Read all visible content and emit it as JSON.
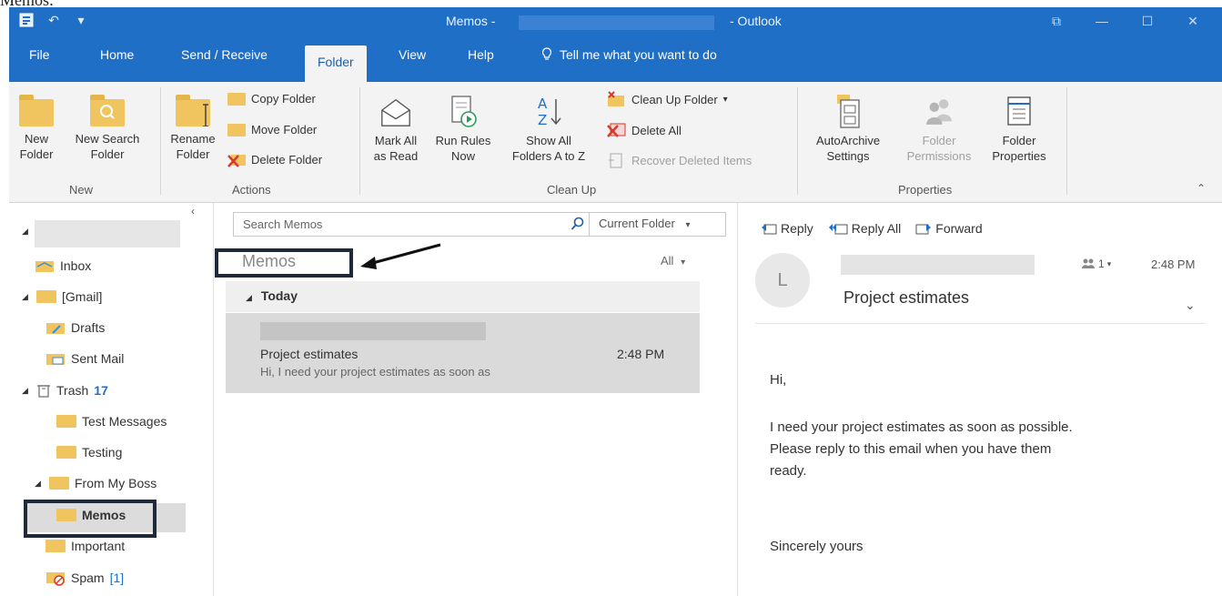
{
  "caption_fragment": "Memos:",
  "window": {
    "title_prefix": "Memos -",
    "title_app": "- Outlook"
  },
  "tabs": [
    {
      "label": "File"
    },
    {
      "label": "Home"
    },
    {
      "label": "Send / Receive"
    },
    {
      "label": "Folder"
    },
    {
      "label": "View"
    },
    {
      "label": "Help"
    }
  ],
  "active_tab": "Folder",
  "tell_me": "Tell me what you want to do",
  "ribbon": {
    "new_group": {
      "label": "New",
      "new_folder": [
        "New",
        "Folder"
      ],
      "new_search_folder": [
        "New Search",
        "Folder"
      ]
    },
    "actions_group": {
      "label": "Actions",
      "rename_folder": [
        "Rename",
        "Folder"
      ],
      "copy_folder": "Copy Folder",
      "move_folder": "Move Folder",
      "delete_folder": "Delete Folder"
    },
    "cleanup_group": {
      "label": "Clean Up",
      "mark_all_read": [
        "Mark All",
        "as Read"
      ],
      "run_rules": [
        "Run Rules",
        "Now"
      ],
      "show_all": [
        "Show All",
        "Folders A to Z"
      ],
      "clean_up_folder": "Clean Up Folder",
      "delete_all": "Delete All",
      "recover_deleted": "Recover Deleted Items"
    },
    "properties_group": {
      "label": "Properties",
      "autoarchive": [
        "AutoArchive",
        "Settings"
      ],
      "folder_permissions": [
        "Folder",
        "Permissions"
      ],
      "folder_properties": [
        "Folder",
        "Properties"
      ]
    }
  },
  "nav": {
    "inbox": "Inbox",
    "gmail": "[Gmail]",
    "drafts": "Drafts",
    "sent_mail": "Sent Mail",
    "trash": "Trash",
    "trash_count": "17",
    "test_messages": "Test Messages",
    "testing": "Testing",
    "from_my_boss": "From My Boss",
    "memos": "Memos",
    "important": "Important",
    "spam": "Spam",
    "spam_count": "[1]"
  },
  "list": {
    "search_placeholder": "Search Memos",
    "scope": "Current Folder",
    "folder_title": "Memos",
    "filter": "All",
    "group": "Today",
    "message": {
      "subject": "Project estimates",
      "time": "2:48 PM",
      "preview": "Hi,  I need your project estimates as soon as"
    }
  },
  "reading": {
    "reply": "Reply",
    "reply_all": "Reply All",
    "forward": "Forward",
    "avatar_initial": "L",
    "people_count": "1",
    "time": "2:48 PM",
    "subject": "Project estimates",
    "body": {
      "greeting": "Hi,",
      "line1": "I need your project estimates as soon as possible.",
      "line2": "Please reply to this email when you have them",
      "line3": "ready.",
      "signoff": "Sincerely yours"
    }
  }
}
